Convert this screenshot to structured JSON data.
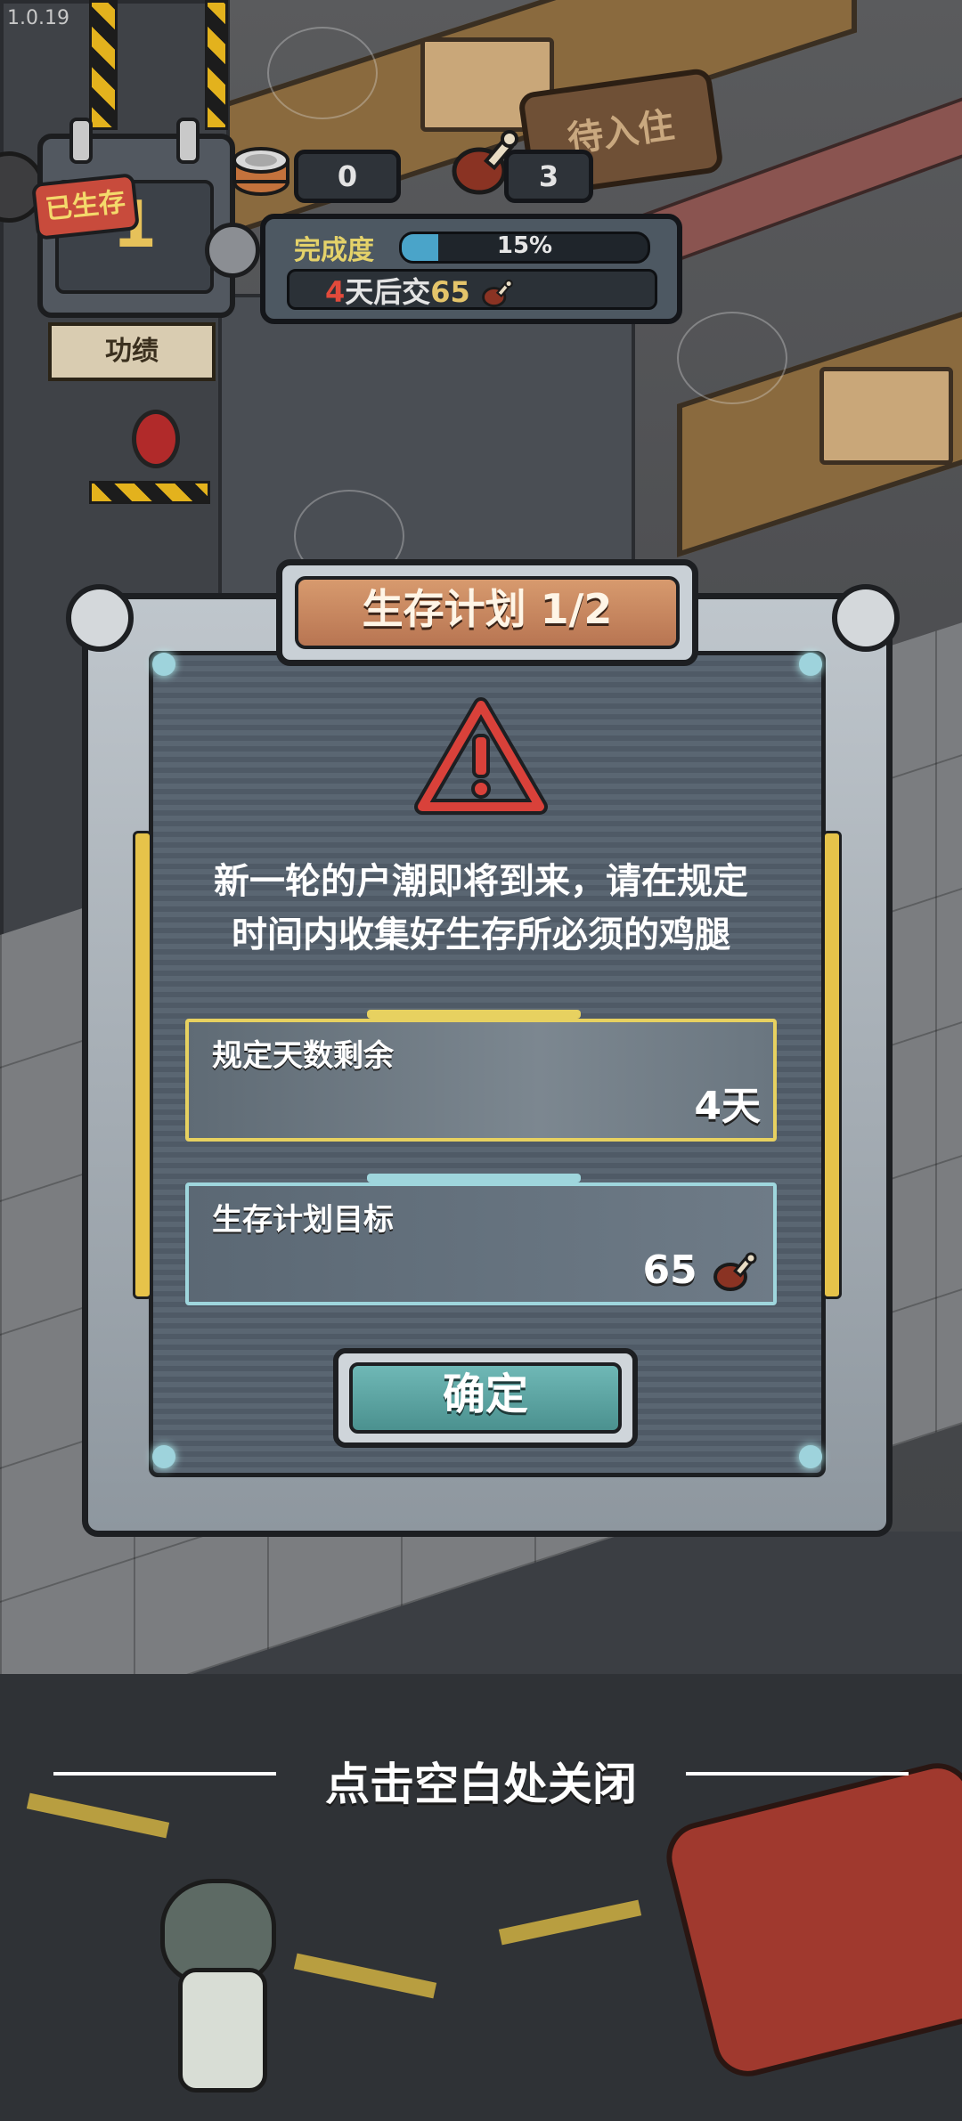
{
  "app": {
    "version": "1.0.19"
  },
  "hud": {
    "survived_tag": "已生存",
    "day_count": "1",
    "merit_label": "功绩",
    "can_count": "0",
    "drumstick_count": "3",
    "completion_label": "完成度",
    "completion_percent": "15%",
    "completion_value": 0.15,
    "deadline_days": "4",
    "deadline_text": "天后交",
    "deadline_goal": "65",
    "room_sign": "待入住"
  },
  "dialog": {
    "title": "生存计划 1/2",
    "message_line1": "新一轮的户潮即将到来，请在规定",
    "message_line2": "时间内收集好生存所必须的鸡腿",
    "days_remaining_label": "规定天数剩余",
    "days_remaining_value": "4天",
    "target_label": "生存计划目标",
    "target_value": "65",
    "confirm_label": "确定"
  },
  "close_hint": "点击空白处关闭",
  "colors": {
    "accent_gold": "#e7d160",
    "accent_cyan": "#9fd6dd",
    "warning_red": "#d9413a",
    "confirm_teal": "#5ea6a4",
    "title_orange": "#c9865f"
  },
  "icons": [
    "warning-icon",
    "drumstick-icon",
    "cat-food-can-icon",
    "gear-icon",
    "close-hint-icon"
  ]
}
